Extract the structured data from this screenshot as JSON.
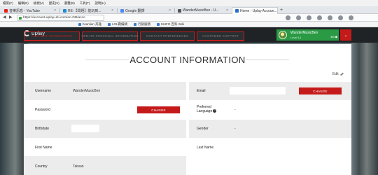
{
  "browser": {
    "menu": [
      "檔案(F)",
      "編輯(E)",
      "檢視(V)",
      "歷史(S)",
      "書籤(B)",
      "工具(T)",
      "說明(H)"
    ],
    "tabs": [
      {
        "label": "音樂訊息 - YouTube",
        "color": "#e62117"
      },
      {
        "label": "RE:【問題】能玩到...",
        "color": "#1c8fd1"
      },
      {
        "label": "Google 翻譯",
        "color": "#4a8af4"
      },
      {
        "label": "WanderMusicBen - U...",
        "color": "#555555"
      },
      {
        "label": "Home - Uplay Accoun...",
        "color": "#2a6fc9"
      }
    ],
    "url": "https://account-uplay.ubi.com/en-GB/acco",
    "bookmarks": [
      "bsanlian 英雄",
      "LOL戰績網",
      "行銷服務",
      "MHFO 百科 Wiki"
    ]
  },
  "site": {
    "brand": "uplay",
    "nav_tabs": [
      "ACCOUNT INFORMATION",
      "UPDATE PERSONAL INFORMATION",
      "CONTACT PREFERENCES",
      "CUSTOMER SUPPORT"
    ],
    "user": {
      "name": "WanderMusicBen",
      "level": "Level 14",
      "coins": "350 ⬢"
    },
    "menu_icon": "chevron-down-icon"
  },
  "account": {
    "title": "ACCOUNT INFORMATION",
    "edit_label": "Edit",
    "change_label": "CHANGE",
    "fields": {
      "username": {
        "label": "Username",
        "value": "WanderMusicBen"
      },
      "email": {
        "label": "Email",
        "value": ""
      },
      "password": {
        "label": "Password"
      },
      "preferred_language": {
        "label_line1": "Preferred",
        "label_line2": "Language",
        "value": "-"
      },
      "birthdate": {
        "label": "Birthdate",
        "value": ""
      },
      "gender": {
        "label": "Gender",
        "value": "-"
      },
      "first_name": {
        "label": "First Name",
        "value": ""
      },
      "last_name": {
        "label": "Last Name",
        "value": ""
      },
      "country": {
        "label": "Country",
        "value": "Taiwan"
      }
    }
  },
  "colors": {
    "accent_red": "#c41a1a",
    "uplay_green": "#2a9a45",
    "nav_dark": "#1f2326"
  }
}
